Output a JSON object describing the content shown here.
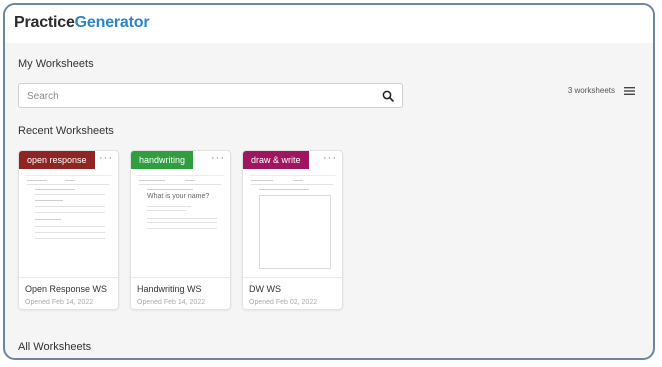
{
  "app": {
    "logo_part1": "Practice",
    "logo_part2": "Generator"
  },
  "page": {
    "title": "My Worksheets",
    "recent_title": "Recent Worksheets",
    "all_title": "All Worksheets"
  },
  "search": {
    "placeholder": "Search",
    "icon": "search-icon"
  },
  "worksheets_count": "3 worksheets",
  "view_toggle_icon": "list-icon",
  "colors": {
    "brand_blue": "#2e83c9",
    "badge_open": "#8e2424",
    "badge_hand": "#2f9e3f",
    "badge_draw": "#a0155f"
  },
  "cards": [
    {
      "badge": "open response",
      "name": "Open Response WS",
      "opened": "Opened Feb 14, 2022"
    },
    {
      "badge": "handwriting",
      "name": "Handwriting WS",
      "opened": "Opened Feb 14, 2022",
      "preview_text": "What is your name?"
    },
    {
      "badge": "draw & write",
      "name": "DW WS",
      "opened": "Opened Feb 02, 2022"
    }
  ],
  "more_label": "···"
}
